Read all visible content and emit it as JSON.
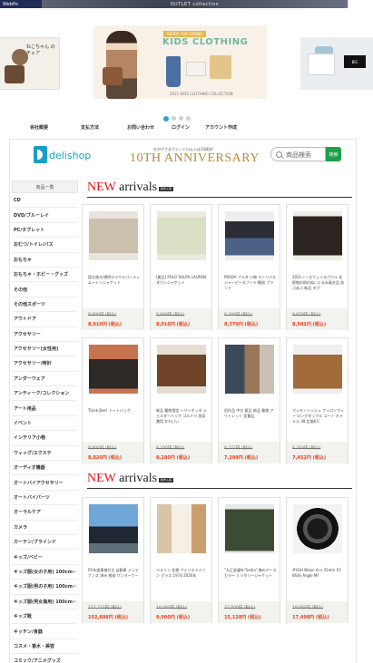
{
  "topstrip": {
    "left": "WebPo",
    "center": "OUTLET collection"
  },
  "carousel": {
    "left_slide_text": "ねこちゃん のチェア",
    "main_banner": "READY FOR SPRING",
    "main_title": "KIDS CLOTHING",
    "main_caption": "2021 KIDS CLOTHING COLLECTION",
    "right_brand": "BIC",
    "active_dot": 0,
    "dot_count": 4
  },
  "nav": {
    "links": [
      "会社概要",
      "支払方法",
      "お問い合わせ",
      "ログイン",
      "アカウント作成"
    ]
  },
  "header": {
    "logo": "delishop",
    "anniv_small": "おかげさまでシートロム入は10周年!",
    "anniv_big": "10TH ANNIVERSARY",
    "search_placeholder": "商品検索",
    "search_button": "検索"
  },
  "sidebar": {
    "title": "商品一覧",
    "items": [
      "CD",
      "DVD/ブルーレイ",
      "PC/タブレット",
      "おむつ/トイレ/バス",
      "おもちゃ",
      "おもちゃ・ホビー・グッズ",
      "その他",
      "その他スポーツ",
      "アウトドア",
      "アクセサリー",
      "アクセサリー(女性用)",
      "アクセサリー/時計",
      "アンダーウェア",
      "アンティーク/コレクション",
      "アート用品",
      "イベント",
      "インテリア小物",
      "ウィッグ/エクステ",
      "オーディオ機器",
      "オートバイアクセサリー",
      "オートバイパーツ",
      "オーラルケア",
      "カメラ",
      "カーテン/ブラインド",
      "キッズ/ベビー",
      "キッズ服(女の子用) 100cm~",
      "キッズ服(男の子用) 100cm~",
      "キッズ服(男女兼用) 100cm~",
      "キッズ靴",
      "キッチン/食器",
      "コスメ・香水・美容",
      "コミック/アニメグッズ"
    ]
  },
  "sections": [
    {
      "title_red": "NEW",
      "title_rest": " arrivals",
      "tag": "新作入荷"
    },
    {
      "title_red": "NEW",
      "title_rest": " arrivals",
      "tag": "新作入荷"
    }
  ],
  "products": [
    {
      "name": "国立夜光/透明ロイヤルパーティ ムートンジャケット",
      "old": "9,900円 (税込)",
      "new": "8,910円 (税込)"
    },
    {
      "name": "[美品] POLO RALPH LAUREN ダウンジャケット",
      "old": "8,900円 (税込)",
      "new": "8,010円 (税込)"
    },
    {
      "name": "PRADA プラダ 小物 ストリパル シャーピースブーツ 靴紐 ブランド",
      "old": "9,300円 (税込)",
      "new": "8,370円 (税込)"
    },
    {
      "name": "2021ノースフェイスパウル 北欧物お柄のぬいぐるみ風お品 あぶあぶ 新品 タグ",
      "old": "9,979円 (税込)",
      "new": "8,981円 (税込)"
    },
    {
      "name": "Think Bee! トートバック",
      "old": "9,800円 (税込)",
      "new": "8,820円 (税込)"
    },
    {
      "name": "新品 最終限定 ハリーポッタ ショルダーバッグ ゴルドバ 男女兼用 かわいい",
      "old": "9,200円 (税込)",
      "new": "8,280円 (税込)"
    },
    {
      "name": "旧作品 中古 夏品 新品 春物 アウトレット 定番品",
      "old": "8,222円 (税込)",
      "new": "7,399円 (税込)"
    },
    {
      "name": "マッキントッシュ フィロソフィー ロングダッフル コート キャメル 38 定価6万",
      "old": "8,269円 (税込)",
      "new": "7,452円 (税込)"
    },
    {
      "name": "R5年度車検付き 自動車 メンテナンス 済み 格安 ワンオーナー",
      "old": "222,222円 (税込)",
      "new": "102,888円 (税込)"
    },
    {
      "name": "ベルリン 花柄 アイリスメイソン グラス 1974-2026年",
      "old": "10,000円 (税込)",
      "new": "9,000円 (税込)"
    },
    {
      "name": "\"大正浪漫年\"Sedia\" 森のアースカラー ミリタリージャケット",
      "old": "22,000円 (税込)",
      "new": "15,128円 (税込)"
    },
    {
      "name": "#SGH Nikon Ai-s 35mm f/2 Wide Angle MF",
      "old": "19,860円 (税込)",
      "new": "17,498円 (税込)"
    }
  ]
}
